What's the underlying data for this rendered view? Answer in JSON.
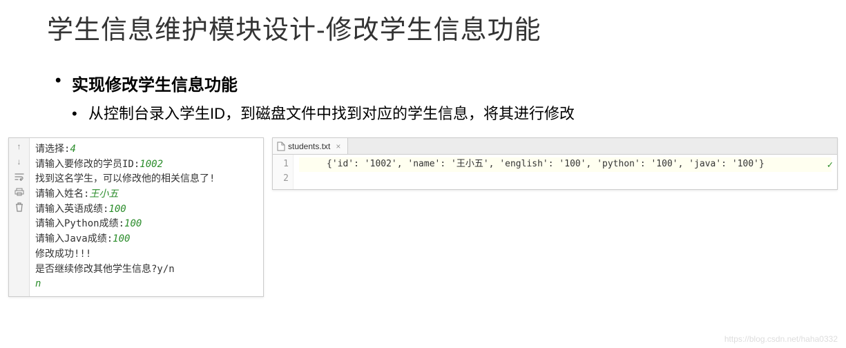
{
  "title": "学生信息维护模块设计-修改学生信息功能",
  "bullets": {
    "main": "实现修改学生信息功能",
    "sub": "从控制台录入学生ID，到磁盘文件中找到对应的学生信息，将其进行修改"
  },
  "console": {
    "lines": [
      {
        "prompt": "请选择:",
        "input": "4"
      },
      {
        "prompt": "请输入要修改的学员ID:",
        "input": "1002"
      },
      {
        "prompt": "找到这名学生，可以修改他的相关信息了!",
        "input": ""
      },
      {
        "prompt": "请输入姓名:",
        "input": "王小五"
      },
      {
        "prompt": "请输入英语成绩:",
        "input": "100"
      },
      {
        "prompt": "请输入Python成绩:",
        "input": "100"
      },
      {
        "prompt": "请输入Java成绩:",
        "input": "100"
      },
      {
        "prompt": "修改成功!!!",
        "input": ""
      },
      {
        "prompt": "是否继续修改其他学生信息?y/n",
        "input": ""
      },
      {
        "prompt": "",
        "input": "n"
      }
    ]
  },
  "editor": {
    "tab_name": "students.txt",
    "gutter": [
      "1",
      "2"
    ],
    "content_line1": "{'id': '1002', 'name': '王小五', 'english': '100', 'python': '100', 'java': '100'}"
  },
  "watermark": "https://blog.csdn.net/haha0332"
}
